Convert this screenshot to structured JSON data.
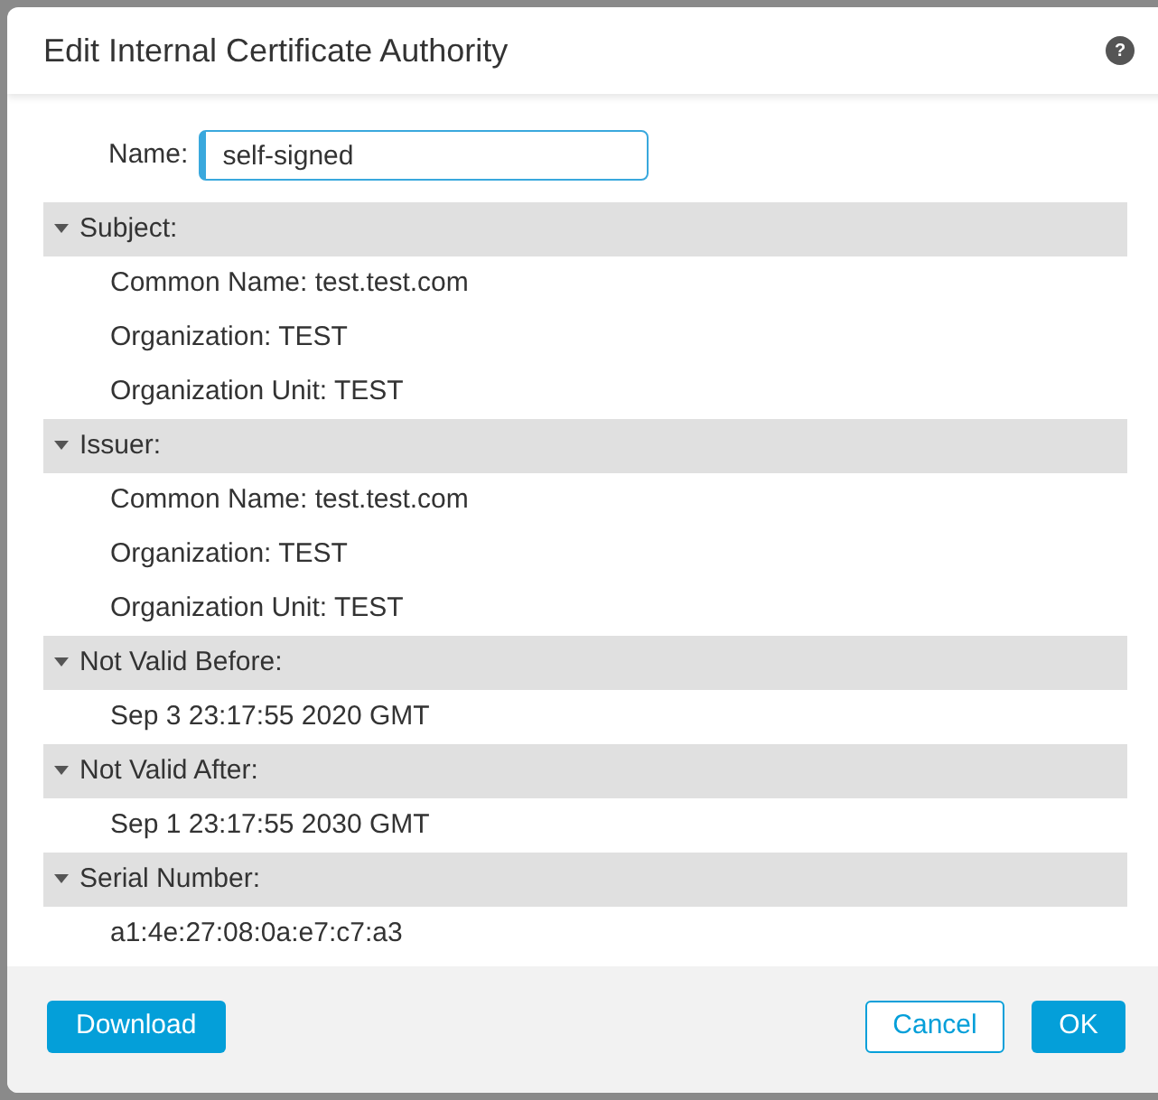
{
  "dialog": {
    "title": "Edit Internal Certificate Authority",
    "help": "?"
  },
  "name_field": {
    "label": "Name:",
    "value": "self-signed"
  },
  "sections": [
    {
      "title": "Subject:",
      "expanded": true,
      "lines": [
        "Common Name: test.test.com",
        "Organization: TEST",
        "Organization Unit: TEST"
      ]
    },
    {
      "title": "Issuer:",
      "expanded": true,
      "lines": [
        "Common Name: test.test.com",
        "Organization: TEST",
        "Organization Unit: TEST"
      ]
    },
    {
      "title": "Not Valid Before:",
      "expanded": true,
      "lines": [
        "Sep 3 23:17:55 2020 GMT"
      ]
    },
    {
      "title": "Not Valid After:",
      "expanded": true,
      "lines": [
        "Sep 1 23:17:55 2030 GMT"
      ]
    },
    {
      "title": "Serial Number:",
      "expanded": true,
      "lines": [
        "a1:4e:27:08:0a:e7:c7:a3"
      ]
    }
  ],
  "buttons": {
    "left": "Download",
    "cancel": "Cancel",
    "ok": "OK"
  }
}
